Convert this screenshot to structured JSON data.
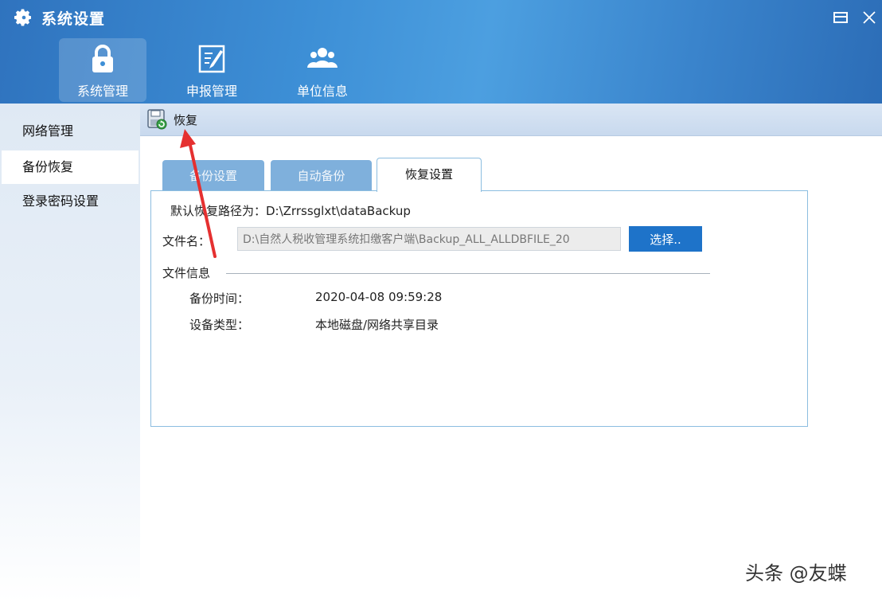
{
  "window": {
    "title": "系统设置",
    "restore_icon": "restore-icon",
    "close_icon": "close-icon"
  },
  "nav": {
    "tabs": [
      {
        "label": "系统管理",
        "icon": "lock-icon",
        "active": true
      },
      {
        "label": "申报管理",
        "icon": "edit-form-icon",
        "active": false
      },
      {
        "label": "单位信息",
        "icon": "users-icon",
        "active": false
      }
    ]
  },
  "sidebar": {
    "items": [
      {
        "label": "网络管理",
        "active": false
      },
      {
        "label": "备份恢复",
        "active": true
      },
      {
        "label": "登录密码设置",
        "active": false
      }
    ]
  },
  "toolbar": {
    "restore_label": "恢复",
    "restore_icon": "restore-disk-icon"
  },
  "tabs": [
    {
      "label": "备份设置",
      "active": false
    },
    {
      "label": "自动备份",
      "active": false
    },
    {
      "label": "恢复设置",
      "active": true
    }
  ],
  "panel": {
    "default_path": "默认恢复路径为：D:\\Zrrssglxt\\dataBackup",
    "file_name_label": "文件名：",
    "file_name_value": "D:\\自然人税收管理系统扣缴客户端\\Backup_ALL_ALLDBFILE_20",
    "choose_label": "选择..",
    "file_info_label": "文件信息",
    "backup_time_label": "备份时间：",
    "backup_time_value": "2020-04-08 09:59:28",
    "device_type_label": "设备类型：",
    "device_type_value": "本地磁盘/网络共享目录"
  },
  "watermark": "头条 @友蝶",
  "colors": {
    "accent": "#1e73c9",
    "banner": "#3d8fd6",
    "annotation": "#e02424"
  }
}
